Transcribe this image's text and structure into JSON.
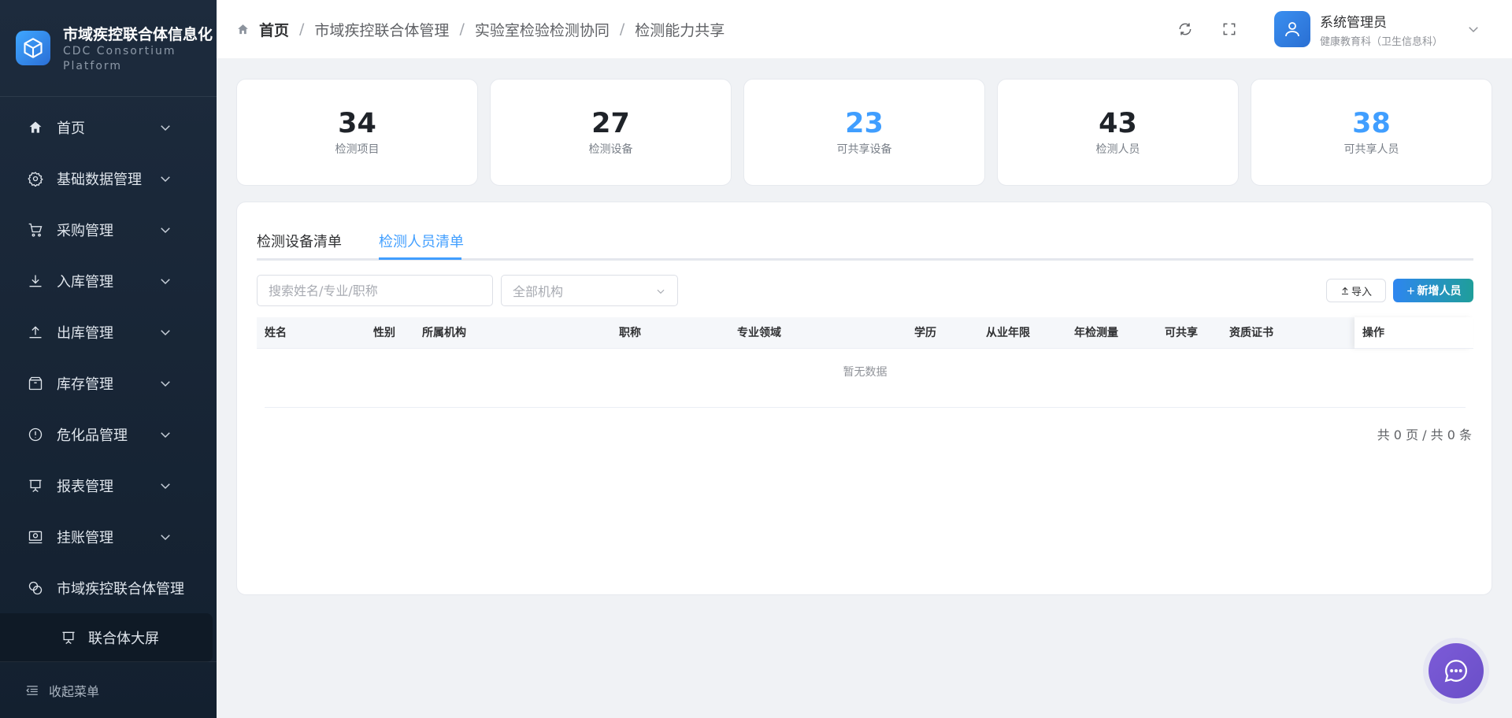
{
  "app": {
    "title": "市域疾控联合体信息化",
    "subtitle_line1": "CDC Consortium",
    "subtitle_line2": "Platform"
  },
  "sidebar": {
    "items": [
      {
        "label": "首页",
        "icon": "home-icon"
      },
      {
        "label": "基础数据管理",
        "icon": "gear-icon"
      },
      {
        "label": "采购管理",
        "icon": "cart-icon"
      },
      {
        "label": "入库管理",
        "icon": "download-icon"
      },
      {
        "label": "出库管理",
        "icon": "upload-icon"
      },
      {
        "label": "库存管理",
        "icon": "box-icon"
      },
      {
        "label": "危化品管理",
        "icon": "warning-icon"
      },
      {
        "label": "报表管理",
        "icon": "presentation-icon"
      },
      {
        "label": "挂账管理",
        "icon": "account-icon"
      },
      {
        "label": "市域疾控联合体管理",
        "icon": "link-icon"
      }
    ],
    "submenu": {
      "label": "联合体大屏",
      "icon": "screen-icon"
    },
    "collapse_label": "收起菜单"
  },
  "header": {
    "breadcrumb": [
      "首页",
      "市域疾控联合体管理",
      "实验室检验检测协同",
      "检测能力共享"
    ],
    "user_name": "系统管理员",
    "user_dept": "健康教育科（卫生信息科）"
  },
  "stats": [
    {
      "value": "34",
      "label": "检测项目",
      "highlight": false
    },
    {
      "value": "27",
      "label": "检测设备",
      "highlight": false
    },
    {
      "value": "23",
      "label": "可共享设备",
      "highlight": true
    },
    {
      "value": "43",
      "label": "检测人员",
      "highlight": false
    },
    {
      "value": "38",
      "label": "可共享人员",
      "highlight": true
    }
  ],
  "tabs": [
    {
      "label": "检测设备清单",
      "active": false
    },
    {
      "label": "检测人员清单",
      "active": true
    }
  ],
  "filters": {
    "search_placeholder": "搜索姓名/专业/职称",
    "org_select": "全部机构"
  },
  "actions": {
    "import_label": "导入",
    "add_label": "新增人员"
  },
  "table": {
    "columns": [
      "姓名",
      "性别",
      "所属机构",
      "职称",
      "专业领域",
      "学历",
      "从业年限",
      "年检测量",
      "可共享",
      "资质证书",
      "操作"
    ],
    "empty_text": "暂无数据"
  },
  "pager": {
    "text": "共 0 页 / 共 0 条"
  },
  "colors": {
    "accent": "#409eff",
    "sidebar": "#1d2b3d"
  }
}
